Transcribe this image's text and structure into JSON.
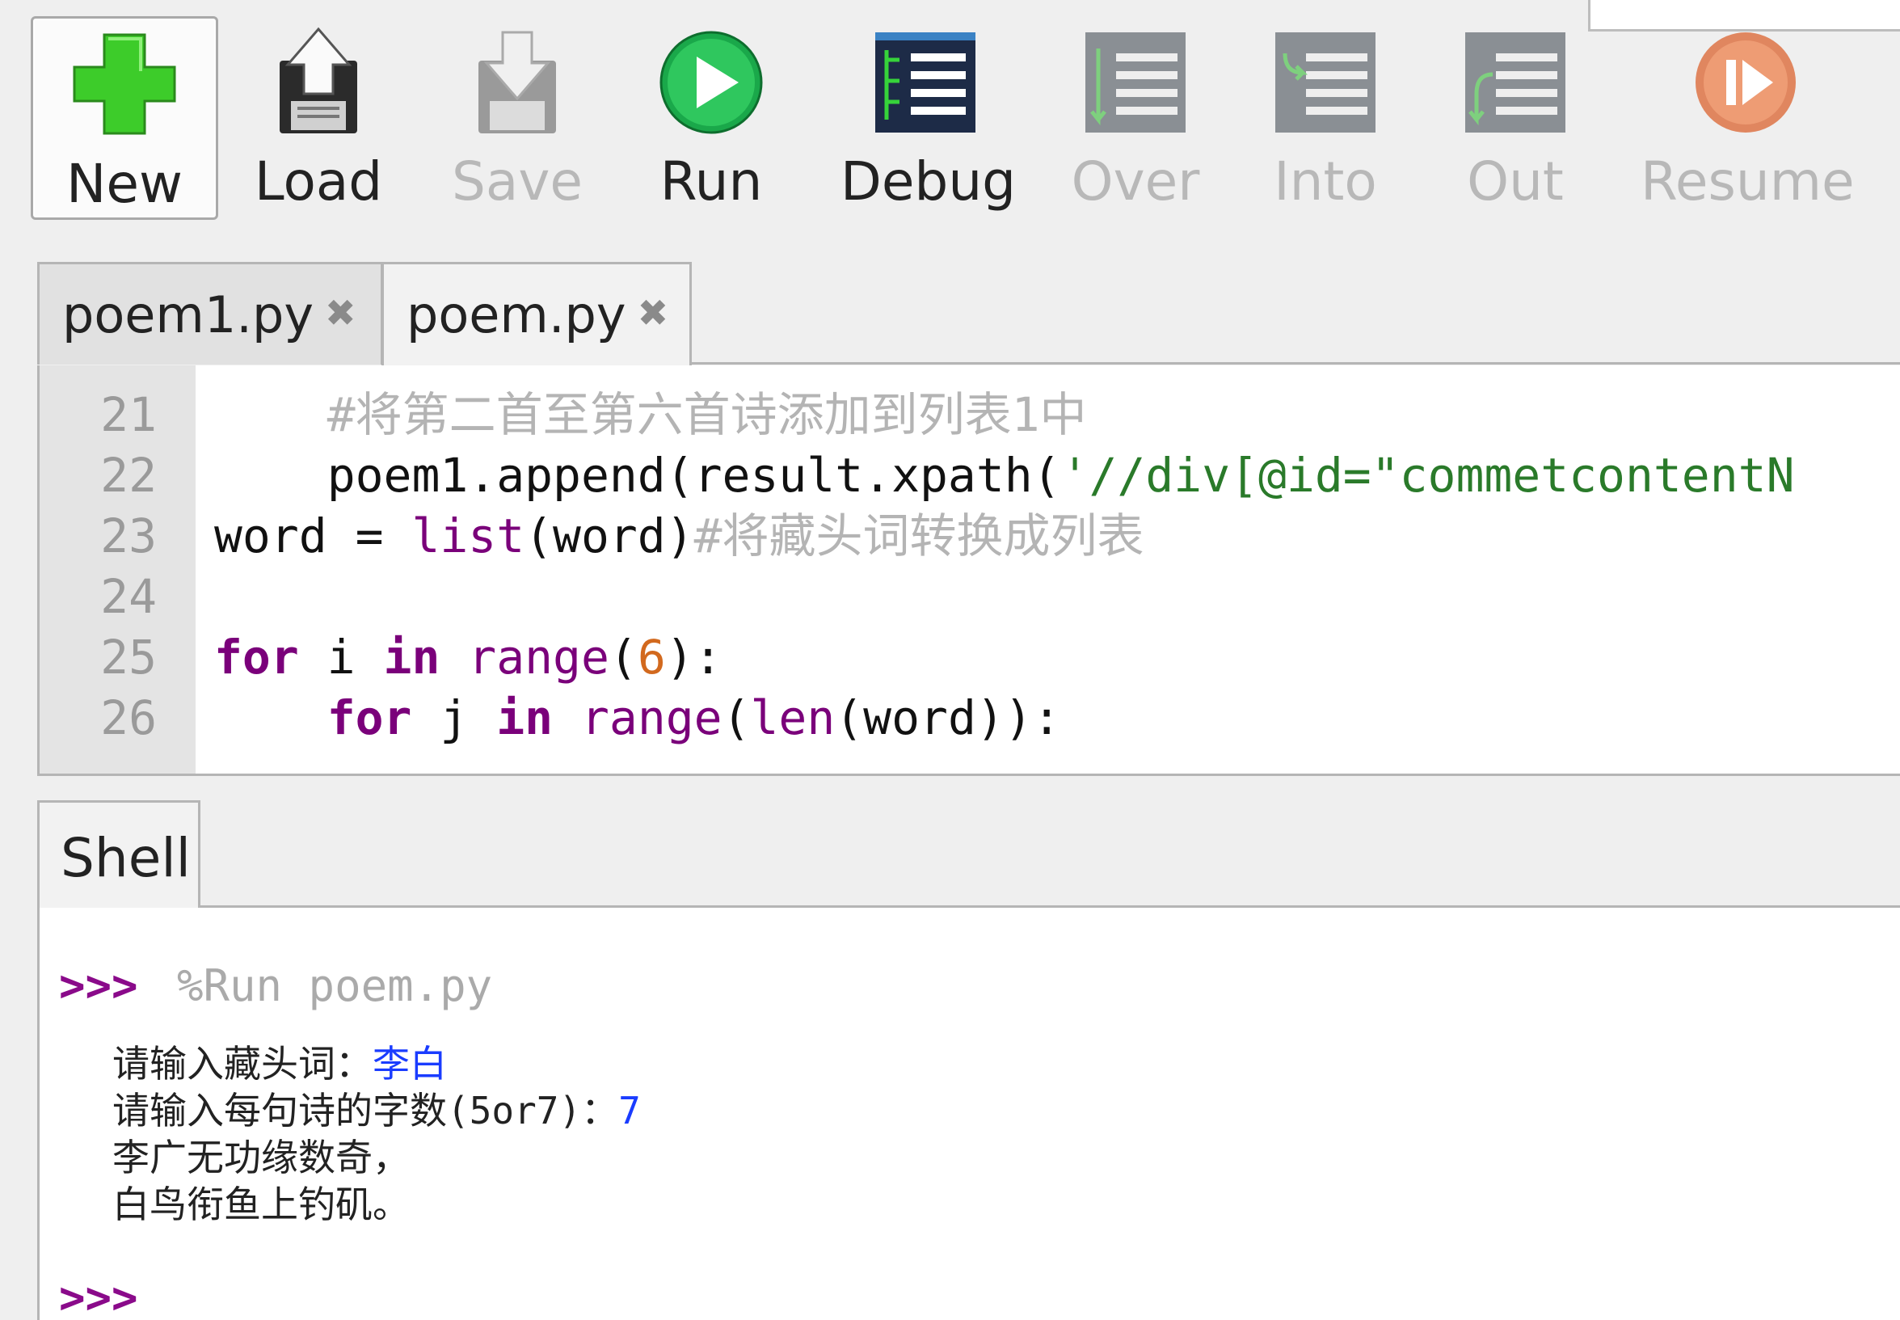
{
  "toolbar": {
    "buttons": [
      {
        "label": "New",
        "icon": "plus-icon"
      },
      {
        "label": "Load",
        "icon": "load-icon"
      },
      {
        "label": "Save",
        "icon": "save-icon"
      },
      {
        "label": "Run",
        "icon": "run-icon"
      },
      {
        "label": "Debug",
        "icon": "debug-icon"
      },
      {
        "label": "Over",
        "icon": "step-over-icon"
      },
      {
        "label": "Into",
        "icon": "step-into-icon"
      },
      {
        "label": "Out",
        "icon": "step-out-icon"
      },
      {
        "label": "Resume",
        "icon": "resume-icon"
      }
    ]
  },
  "editor": {
    "tabs": [
      {
        "label": "poem1.py"
      },
      {
        "label": "poem.py"
      }
    ],
    "close_glyph": "✖",
    "line_numbers": [
      "21",
      "22",
      "23",
      "24",
      "25",
      "26"
    ],
    "lines": {
      "l21_indent": "    ",
      "l21_comment": "#将第二首至第六首诗添加到列表1中",
      "l22_indent": "    ",
      "l22_code": "poem1.append(result.xpath(",
      "l22_str": "'//div[@id=\"commetcontentN",
      "l23_pre": "word = ",
      "l23_builtin": "list",
      "l23_post": "(word)",
      "l23_comment": "#将藏头词转换成列表",
      "l25_for": "for",
      "l25_mid": " i ",
      "l25_in": "in",
      "l25_range": " range",
      "l25_open": "(",
      "l25_num": "6",
      "l25_close": "):",
      "l26_indent": "    ",
      "l26_for": "for",
      "l26_mid": " j ",
      "l26_in": "in",
      "l26_range": " range",
      "l26_open": "(",
      "l26_len": "len",
      "l26_close": "(word)):"
    }
  },
  "shell": {
    "tab_label": "Shell",
    "prompt": ">>>",
    "command": "%Run poem.py",
    "output": [
      {
        "text": "请输入藏头词：",
        "input": "李白"
      },
      {
        "text": "请输入每句诗的字数(5or7)：",
        "input": "7"
      },
      {
        "text": "李广无功缘数奇，",
        "input": ""
      },
      {
        "text": "白鸟衔鱼上钓矶。",
        "input": ""
      }
    ],
    "prompt2": ">>>"
  },
  "colors": {
    "keyword": "#7a007a",
    "number": "#d2691e",
    "string": "#2a7a2a",
    "comment": "#b4b4b4",
    "prompt": "#8a0a8a",
    "user_input": "#1a3cff"
  }
}
